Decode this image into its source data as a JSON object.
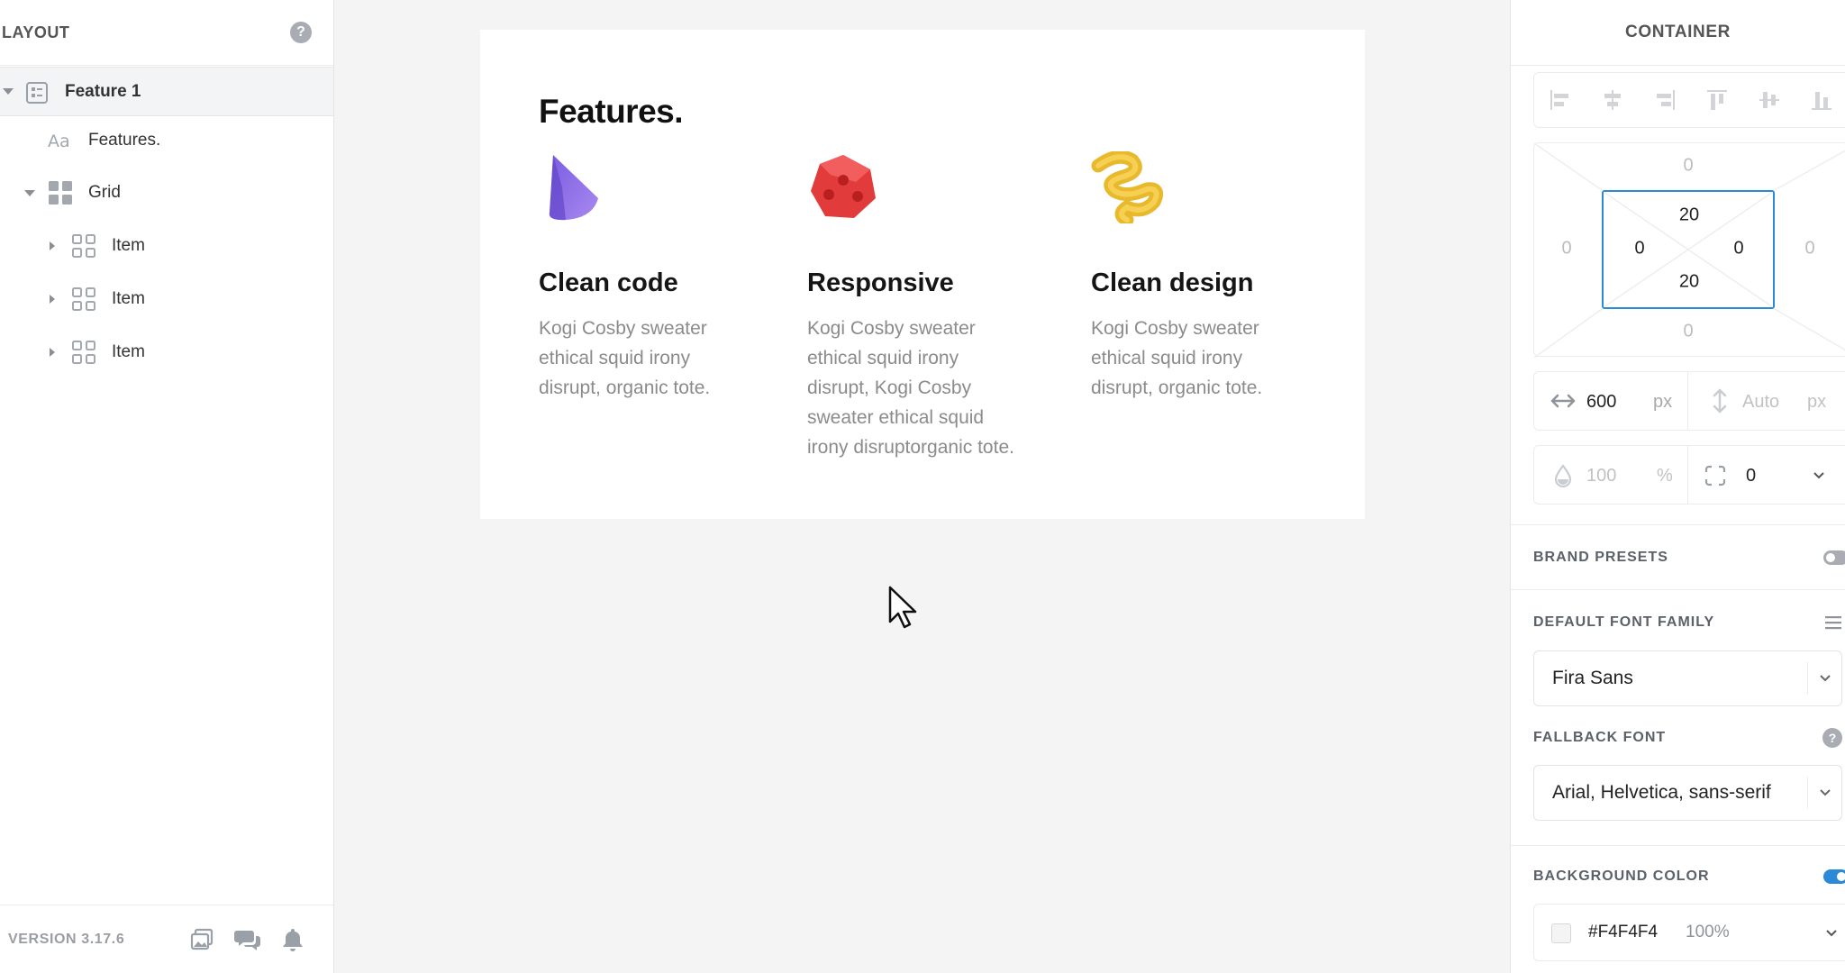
{
  "sidebar": {
    "title": "LAYOUT",
    "help": "?",
    "tree": [
      {
        "label": "Feature 1",
        "icon": "section-icon"
      },
      {
        "label": "Features.",
        "icon": "text-icon"
      },
      {
        "label": "Grid",
        "icon": "grid-icon"
      },
      {
        "label": "Item",
        "icon": "item-icon"
      },
      {
        "label": "Item",
        "icon": "item-icon"
      },
      {
        "label": "Item",
        "icon": "item-icon"
      }
    ],
    "version": "VERSION 3.17.6"
  },
  "canvas": {
    "title": "Features.",
    "features": [
      {
        "title": "Clean code",
        "description": "Kogi Cosby sweater ethical squid irony disrupt, organic tote.",
        "icon": "purple-cone-icon"
      },
      {
        "title": "Responsive",
        "description": "Kogi Cosby sweater ethical squid irony disrupt, Kogi Cosby sweater ethical squid irony disruptorganic tote.",
        "icon": "red-cube-icon"
      },
      {
        "title": "Clean design",
        "description": "Kogi Cosby sweater ethical squid irony disrupt, organic tote.",
        "icon": "yellow-spiral-icon"
      }
    ]
  },
  "panel": {
    "title": "CONTAINER",
    "spacing": {
      "margin_top": "0",
      "margin_right": "0",
      "margin_bottom": "0",
      "margin_left": "0",
      "padding_top": "20",
      "padding_right": "0",
      "padding_bottom": "20",
      "padding_left": "0"
    },
    "width": {
      "value": "600",
      "unit": "px"
    },
    "height": {
      "value": "Auto",
      "unit": "px"
    },
    "opacity": {
      "value": "100",
      "unit": "%"
    },
    "radius": {
      "value": "0"
    },
    "brand_presets": {
      "label": "BRAND PRESETS",
      "enabled": false
    },
    "default_font": {
      "label": "DEFAULT FONT FAMILY",
      "value": "Fira Sans"
    },
    "fallback_font": {
      "label": "FALLBACK FONT",
      "value": "Arial, Helvetica, sans-serif",
      "help": "?"
    },
    "background": {
      "label": "BACKGROUND COLOR",
      "enabled": true,
      "hex": "#F4F4F4",
      "opacity": "100%",
      "swatch": "#F4F4F4"
    }
  },
  "colors": {
    "accent": "#2B8AD8",
    "selected_row": "#F3F4F6"
  }
}
